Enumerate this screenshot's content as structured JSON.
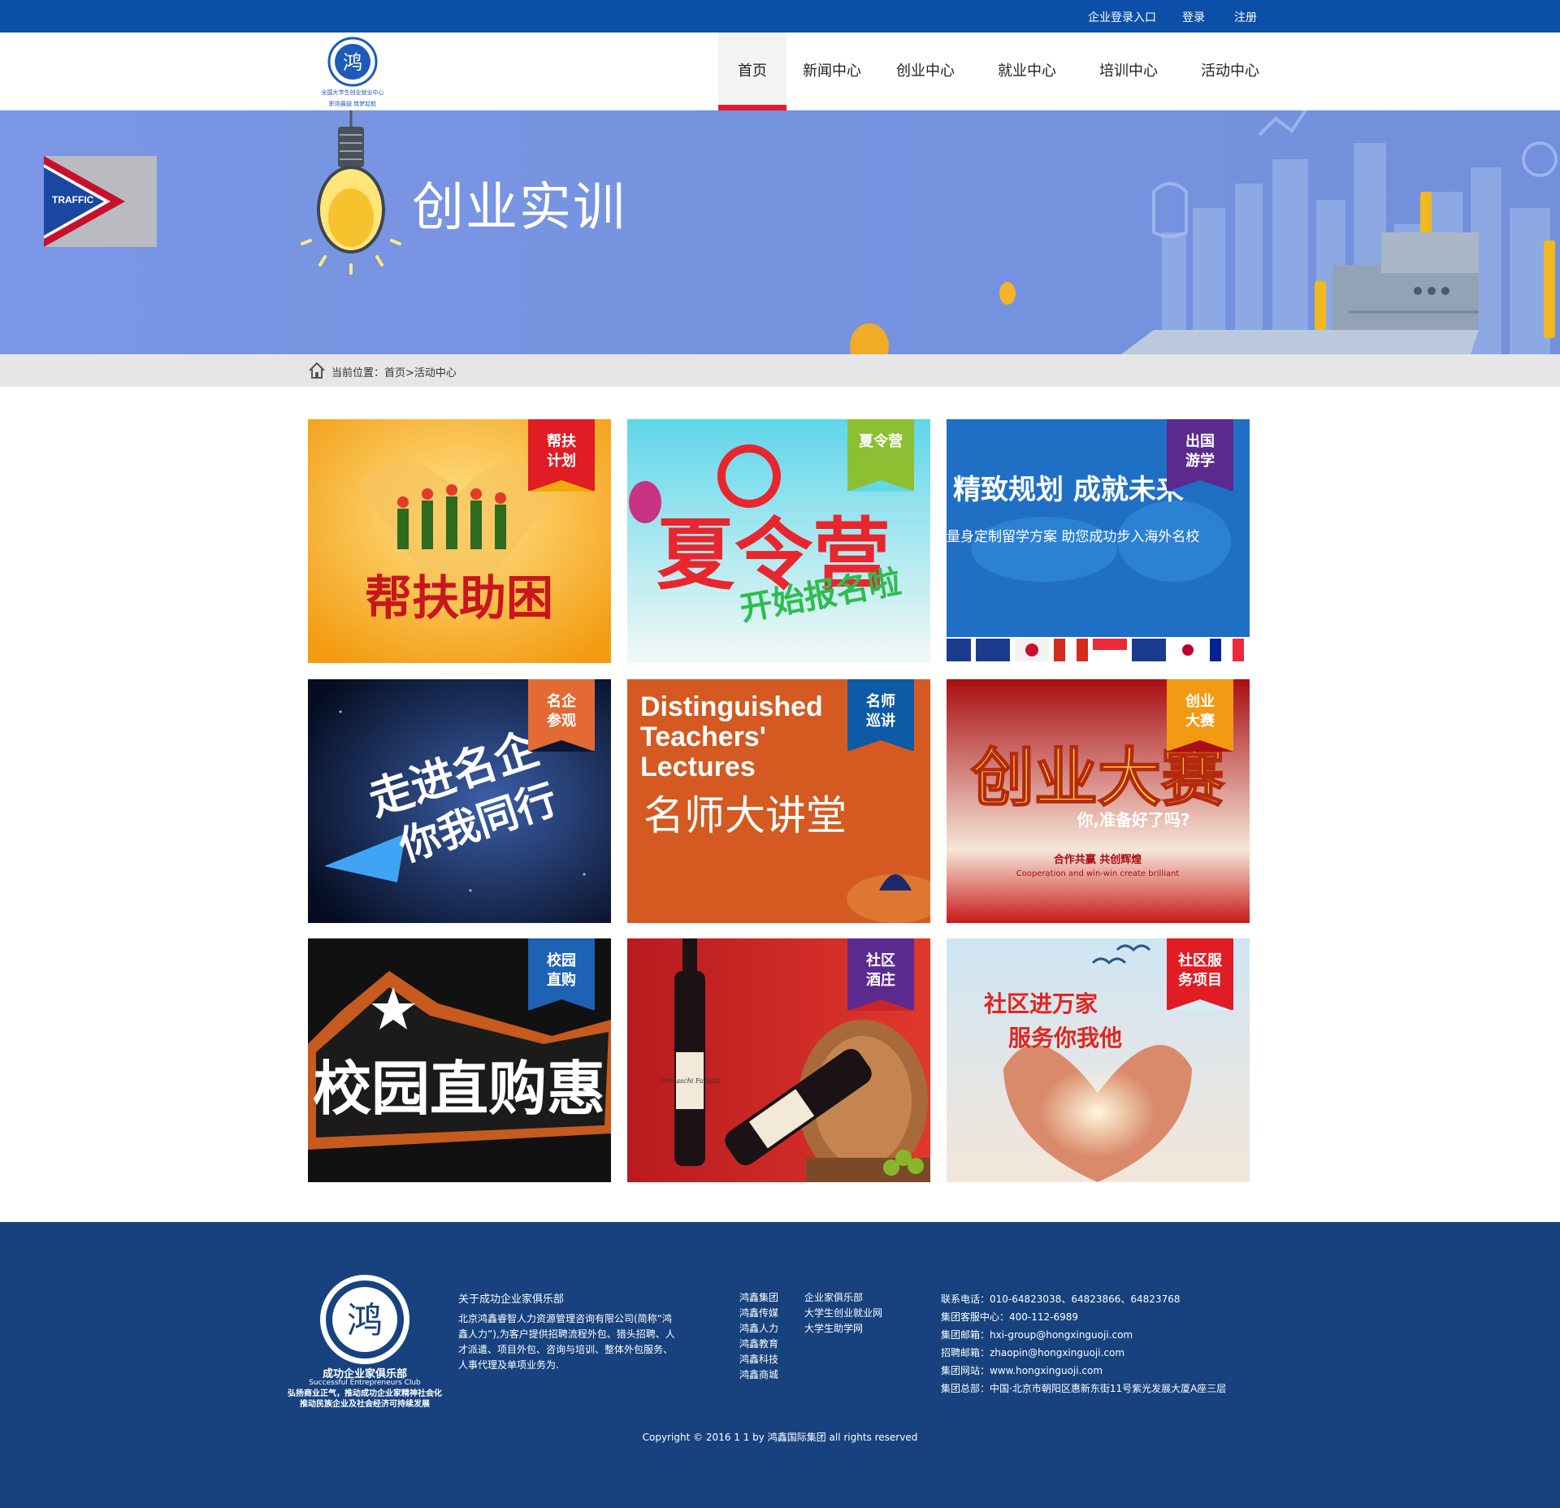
{
  "topbar": {
    "enterprise_login": "企业登录入口",
    "login": "登录",
    "register": "注册"
  },
  "nav": [
    "首页",
    "新闻中心",
    "创业中心",
    "就业中心",
    "培训中心",
    "活动中心"
  ],
  "logo": {
    "org_name": "全国大学生创业就业中心",
    "slogan": "职场展翅   筑梦起航"
  },
  "banner": {
    "title": "创业实训",
    "traffic_label": "TRAFFIC"
  },
  "breadcrumb": "当前位置：首页>活动中心",
  "cards": [
    {
      "tag1": "帮扶",
      "tag2": "计划",
      "art": "帮扶助困",
      "tag_color": "#e01c24",
      "cut_color": "#f3a90c"
    },
    {
      "tag1": "夏令营",
      "tag2": "",
      "art": "夏令营",
      "art2": "开始报名啦",
      "tag_color": "#8cbf32",
      "cut_color": "#62d9e6"
    },
    {
      "tag1": "出国",
      "tag2": "游学",
      "art": "精致规划  成就未来",
      "art2": "量身定制留学方案  助您成功步入海外名校",
      "tag_color": "#5b2a8f",
      "cut_color": "#1f6fc4"
    },
    {
      "tag1": "名企",
      "tag2": "参观",
      "art": "走进名企",
      "art2": "你我同行",
      "tag_color": "#e46a34",
      "cut_color": "#0b1633"
    },
    {
      "tag1": "名师",
      "tag2": "巡讲",
      "art": "Distinguished Teachers' Lectures",
      "art2": "名师大讲堂",
      "tag_color": "#0d5aa7",
      "cut_color": "#d45a22"
    },
    {
      "tag1": "创业",
      "tag2": "大赛",
      "art": "创业大赛",
      "art2": "你,准备好了吗?",
      "art3": "合作共赢 共创辉煌",
      "art4": "Cooperation and win-win create brilliant",
      "tag_color": "#f39a14",
      "cut_color": "#a90e12"
    },
    {
      "tag1": "校园",
      "tag2": "直购",
      "art": "校园直购惠",
      "tag_color": "#1e62b4",
      "cut_color": "#111111"
    },
    {
      "tag1": "社区",
      "tag2": "酒庄",
      "art": "Crimaschi Farlatti",
      "tag_color": "#5b2a8f",
      "cut_color": "#c8252a"
    },
    {
      "tag1": "社区服",
      "tag2": "务项目",
      "art": "社区进万家",
      "art2": "服务你我他",
      "tag_color": "#e01c24",
      "cut_color": "#d8ecf6"
    }
  ],
  "footer": {
    "club_name": "成功企业家俱乐部",
    "club_en": "Successful Entrepreneurs Club",
    "slogan1": "弘扬商业正气，推动成功企业家精神社会化",
    "slogan2": "推动民族企业及社会经济可持续发展",
    "about_title": "关于成功企业家俱乐部",
    "about_text": "北京鸿鑫睿智人力资源管理咨询有限公司(简称“鸿鑫人力”),为客户提供招聘流程外包、猎头招聘、人才派遣、项目外包、咨询与培训、整体外包服务、人事代理及单项业务为.",
    "links1": [
      "鸿鑫集团",
      "鸿鑫传媒",
      "鸿鑫人力",
      "鸿鑫教育",
      "鸿鑫科技",
      "鸿鑫商城"
    ],
    "links2": [
      "企业家俱乐部",
      "大学生创业就业网",
      "大学生助学网"
    ],
    "contact": [
      "联系电话：010-64823038、64823866、64823768",
      "集团客服中心：400-112-6989",
      "集团邮箱：hxi-group@hongxinguoji.com",
      "招聘邮箱：zhaopin@hongxinguoji.com",
      "集团网站：www.hongxinguoji.com",
      "集团总部：中国·北京市朝阳区惠新东街11号紫光发展大厦A座三层"
    ],
    "copyright": "Copyright © 2016 1 1 by 鸿鑫国际集团 all rights reserved"
  },
  "colors": {
    "topbar": "#0b4fa8",
    "nav_active": "#e8192c",
    "banner": "#7994e2",
    "footer": "#17427e"
  }
}
